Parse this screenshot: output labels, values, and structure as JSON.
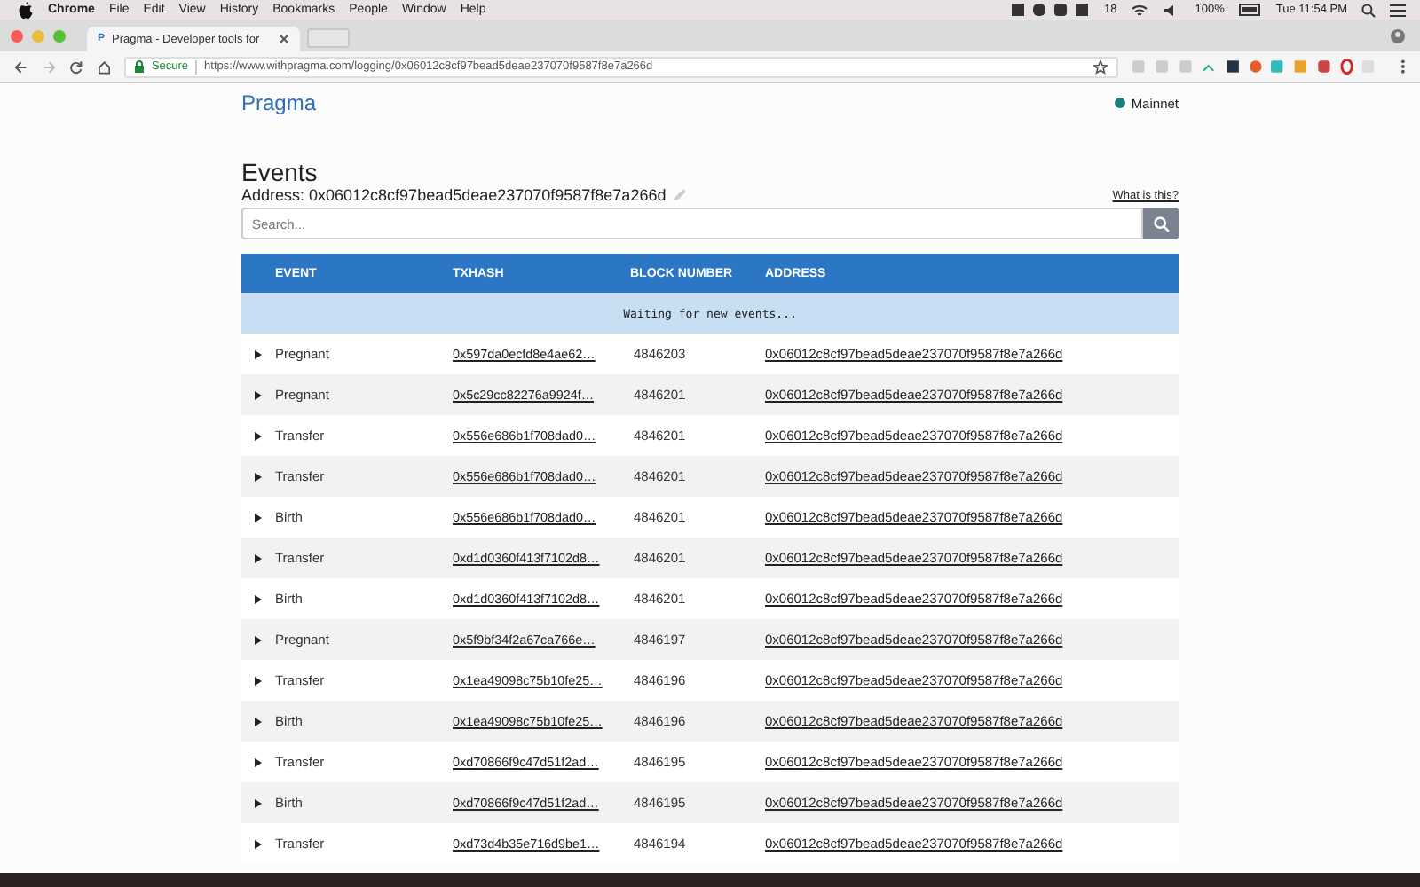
{
  "menu_bar": {
    "app": "Chrome",
    "items": [
      "File",
      "Edit",
      "View",
      "History",
      "Bookmarks",
      "People",
      "Window",
      "Help"
    ],
    "badge_count": "18",
    "battery": "100%",
    "clock": "Tue 11:54 PM"
  },
  "browser": {
    "tab": {
      "title": "Pragma - Developer tools for",
      "favicon": "P"
    },
    "secure_label": "Secure",
    "url": "https://www.withpragma.com/logging/0x06012c8cf97bead5deae237070f9587f8e7a266d"
  },
  "header": {
    "logo": "Pragma",
    "network": {
      "label": "Mainnet",
      "color": "#1a7f7a"
    }
  },
  "page": {
    "title": "Events",
    "address_label": "Address: 0x06012c8cf97bead5deae237070f9587f8e7a266d",
    "help_link": "What is this?",
    "search": {
      "placeholder": "Search..."
    }
  },
  "table": {
    "columns": [
      "EVENT",
      "TXHASH",
      "BLOCK NUMBER",
      "ADDRESS"
    ],
    "status": "Waiting for new events...",
    "rows": [
      {
        "event": "Pregnant",
        "txhash": "0x597da0ecfd8e4ae62…",
        "block": "4846203",
        "address": "0x06012c8cf97bead5deae237070f9587f8e7a266d",
        "expanded": false
      },
      {
        "event": "Pregnant",
        "txhash": "0x5c29cc82276a9924f…",
        "block": "4846201",
        "address": "0x06012c8cf97bead5deae237070f9587f8e7a266d",
        "expanded": false
      },
      {
        "event": "Transfer",
        "txhash": "0x556e686b1f708dad0…",
        "block": "4846201",
        "address": "0x06012c8cf97bead5deae237070f9587f8e7a266d",
        "expanded": false
      },
      {
        "event": "Transfer",
        "txhash": "0x556e686b1f708dad0…",
        "block": "4846201",
        "address": "0x06012c8cf97bead5deae237070f9587f8e7a266d",
        "expanded": false
      },
      {
        "event": "Birth",
        "txhash": "0x556e686b1f708dad0…",
        "block": "4846201",
        "address": "0x06012c8cf97bead5deae237070f9587f8e7a266d",
        "expanded": false
      },
      {
        "event": "Transfer",
        "txhash": "0xd1d0360f413f7102d8…",
        "block": "4846201",
        "address": "0x06012c8cf97bead5deae237070f9587f8e7a266d",
        "expanded": false
      },
      {
        "event": "Birth",
        "txhash": "0xd1d0360f413f7102d8…",
        "block": "4846201",
        "address": "0x06012c8cf97bead5deae237070f9587f8e7a266d",
        "expanded": false
      },
      {
        "event": "Pregnant",
        "txhash": "0x5f9bf34f2a67ca766e…",
        "block": "4846197",
        "address": "0x06012c8cf97bead5deae237070f9587f8e7a266d",
        "expanded": false
      },
      {
        "event": "Transfer",
        "txhash": "0x1ea49098c75b10fe25…",
        "block": "4846196",
        "address": "0x06012c8cf97bead5deae237070f9587f8e7a266d",
        "expanded": false
      },
      {
        "event": "Birth",
        "txhash": "0x1ea49098c75b10fe25…",
        "block": "4846196",
        "address": "0x06012c8cf97bead5deae237070f9587f8e7a266d",
        "expanded": false
      },
      {
        "event": "Transfer",
        "txhash": "0xd70866f9c47d51f2ad…",
        "block": "4846195",
        "address": "0x06012c8cf97bead5deae237070f9587f8e7a266d",
        "expanded": false
      },
      {
        "event": "Birth",
        "txhash": "0xd70866f9c47d51f2ad…",
        "block": "4846195",
        "address": "0x06012c8cf97bead5deae237070f9587f8e7a266d",
        "expanded": false
      },
      {
        "event": "Transfer",
        "txhash": "0xd73d4b35e716d9be1…",
        "block": "4846194",
        "address": "0x06012c8cf97bead5deae237070f9587f8e7a266d",
        "expanded": false
      }
    ]
  }
}
